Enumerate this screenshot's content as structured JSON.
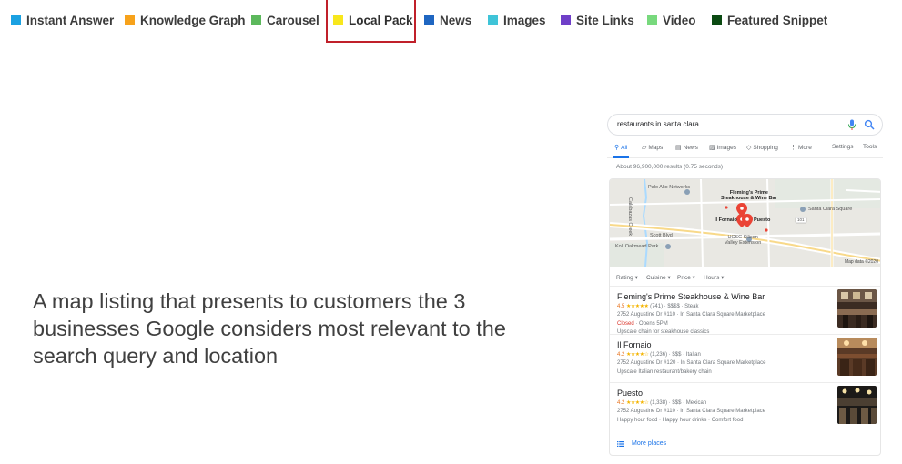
{
  "legend": {
    "items": [
      {
        "label": "Instant Answer",
        "color": "#1ba1e2",
        "active": false
      },
      {
        "label": "Knowledge Graph",
        "color": "#f7a21b",
        "active": false
      },
      {
        "label": "Carousel",
        "color": "#5cb85c",
        "active": false
      },
      {
        "label": "Local Pack",
        "color": "#f8e71c",
        "active": true
      },
      {
        "label": "News",
        "color": "#1f66c1",
        "active": false
      },
      {
        "label": "Images",
        "color": "#3fc4d8",
        "active": false
      },
      {
        "label": "Site Links",
        "color": "#6f3fc8",
        "active": false
      },
      {
        "label": "Video",
        "color": "#78d97d",
        "active": false
      },
      {
        "label": "Featured Snippet",
        "color": "#0b4a12",
        "active": false
      }
    ],
    "highlight_color": "#c0202a"
  },
  "description": "A map listing that presents to customers the 3 businesses Google considers most relevant to the search query and location",
  "serp": {
    "query": "restaurants in santa clara",
    "tabs": [
      {
        "label": "All",
        "icon": "search-icon",
        "active": true
      },
      {
        "label": "Maps",
        "icon": "map-icon",
        "active": false
      },
      {
        "label": "News",
        "icon": "news-icon",
        "active": false
      },
      {
        "label": "Images",
        "icon": "image-icon",
        "active": false
      },
      {
        "label": "Shopping",
        "icon": "tag-icon",
        "active": false
      },
      {
        "label": "More",
        "icon": "more-icon",
        "active": false
      }
    ],
    "settings_label": "Settings",
    "tools_label": "Tools",
    "result_stats": "About 96,900,000 results (0.75 seconds)",
    "map": {
      "labels": {
        "palo_alto": "Palo Alto Networks",
        "flemings_line1": "Fleming's Prime",
        "flemings_line2": "Steakhouse & Wine Bar",
        "il_fornaio": "Il Fornaio",
        "puesto": "Puesto",
        "santa_clara_square": "Santa Clara Square",
        "scott_blvd": "Scott Blvd",
        "ucsc_line1": "UCSC Silicon",
        "ucsc_line2": "Valley Extension",
        "koll_park": "Koll Oakmead Park",
        "calabazas": "Calabazas Creek",
        "route": "101",
        "credit": "Map data ©2020"
      }
    },
    "filters": [
      "Rating",
      "Cuisine",
      "Price",
      "Hours"
    ],
    "listings": [
      {
        "name": "Fleming's Prime Steakhouse & Wine Bar",
        "rating": "4.5",
        "stars": "★★★★★",
        "meta": "(741) · $$$$ · Steak",
        "address": "2752 Augustine Dr #110 · In Santa Clara Square Marketplace",
        "status": "Closed",
        "hours": "· Opens 5PM",
        "description": "Upscale chain for steakhouse classics"
      },
      {
        "name": "Il Fornaio",
        "rating": "4.2",
        "stars": "★★★★☆",
        "meta": "(1,236) · $$$ · Italian",
        "address": "2752 Augustine Dr #120 · In Santa Clara Square Marketplace",
        "description": "Upscale Italian restaurant/bakery chain"
      },
      {
        "name": "Puesto",
        "rating": "4.2",
        "stars": "★★★★☆",
        "meta": "(1,338) · $$$ · Mexican",
        "address": "2752 Augustine Dr #110 · In Santa Clara Square Marketplace",
        "description": "Happy hour food · Happy hour drinks · Comfort food"
      }
    ],
    "more_places": "More places"
  }
}
